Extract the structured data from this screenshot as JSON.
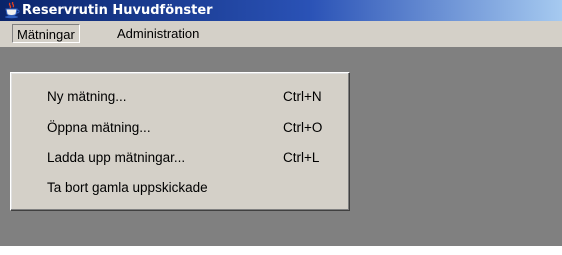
{
  "window": {
    "title": "Reservrutin Huvudfönster",
    "icon": "java-cup-icon"
  },
  "menubar": {
    "menus": [
      {
        "label": "Mätningar",
        "open": true
      },
      {
        "label": "Administration",
        "open": false
      }
    ]
  },
  "dropdown": {
    "items": [
      {
        "label": "Ny mätning...",
        "shortcut": "Ctrl+N"
      },
      {
        "label": "Öppna mätning...",
        "shortcut": "Ctrl+O"
      },
      {
        "label": "Ladda upp mätningar...",
        "shortcut": "Ctrl+L"
      },
      {
        "label": "Ta bort gamla uppskickade",
        "shortcut": ""
      }
    ]
  },
  "colors": {
    "titlebar_start": "#0a246a",
    "titlebar_end": "#a6caf0",
    "menu_background": "#d4d0c8",
    "desktop_background": "#808080"
  }
}
